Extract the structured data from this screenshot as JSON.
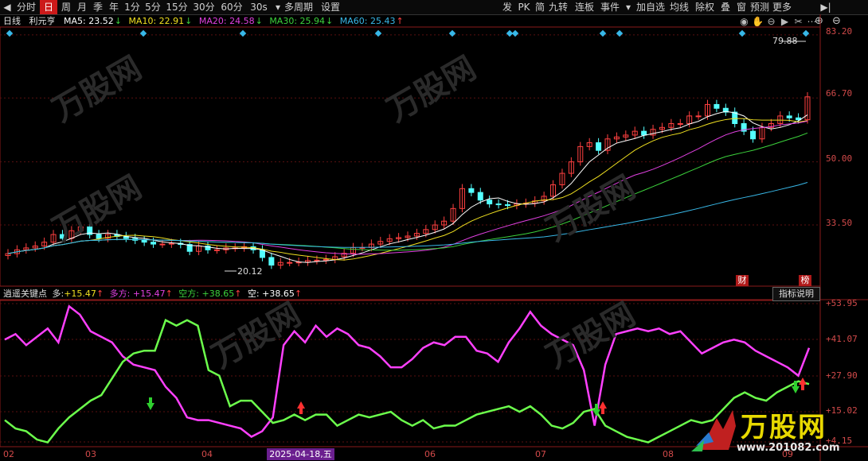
{
  "toolbar": {
    "left_arrow": "◀",
    "periods": [
      "分时",
      "日",
      "周",
      "月",
      "季",
      "年",
      "1分",
      "5分",
      "15分",
      "30分",
      "60分",
      "30s",
      "多周期",
      "设置"
    ],
    "active_period": "日",
    "seconds_dropdown": "▾",
    "tools": [
      "发",
      "PK",
      "简",
      "九转",
      "连板",
      "事件"
    ],
    "tools_dropdown": "▾",
    "right_tools": [
      "加自选",
      "均线",
      "除权",
      "叠",
      "窗",
      "预测",
      "更多"
    ],
    "right_arrow": "▶|"
  },
  "main_legend": {
    "period": "日线",
    "stock_name": "利元亨",
    "ma5": {
      "label": "MA5: 23.52",
      "arrow": "↓",
      "color": "#ffffff"
    },
    "ma10": {
      "label": "MA10: 22.91",
      "arrow": "↓",
      "color": "#f0e020"
    },
    "ma20": {
      "label": "MA20: 24.58",
      "arrow": "↓",
      "color": "#e040e0"
    },
    "ma30": {
      "label": "MA30: 25.94",
      "arrow": "↓",
      "color": "#3cd23c"
    },
    "ma60": {
      "label": "MA60: 25.43",
      "arrow": "↑",
      "color": "#38b8e8"
    }
  },
  "chart_icons": [
    "eye-icon",
    "hand-icon",
    "minus-circle-icon",
    "play-circle-icon",
    "scissors-icon",
    "dots-icon"
  ],
  "chart_icon_glyphs": [
    "◉",
    "✋",
    "⊖",
    "▶",
    "✂",
    "⋯"
  ],
  "zoom": {
    "plus": "⊕",
    "minus": "⊖"
  },
  "price_axis": [
    "83.20",
    "66.70",
    "50.00",
    "33.50"
  ],
  "price_high_label": "79.88",
  "price_low_label": "20.12",
  "tags": [
    {
      "text": "财",
      "color": "#b01a1a"
    },
    {
      "text": "榜",
      "color": "#b01a1a"
    }
  ],
  "indicator_legend": {
    "name": "逍遥关键点",
    "duo": {
      "label": "多: +15.47",
      "arrow": "↑",
      "color": "#f0e020"
    },
    "duofang": {
      "label": "多方: +15.47",
      "arrow": "↑",
      "color": "#e040e0"
    },
    "kongfang": {
      "label": "空方: +38.65",
      "arrow": "↑",
      "color": "#3cd23c"
    },
    "kong": {
      "label": "空: +38.65",
      "arrow": "↑",
      "color": "#ffffff"
    }
  },
  "explain_button": "指标说明",
  "indicator_axis": [
    "+53.95",
    "+41.07",
    "+27.90",
    "+15.02",
    "+4.15"
  ],
  "date_axis": [
    "02",
    "03",
    "04",
    "06",
    "07",
    "08",
    "09"
  ],
  "date_highlight": "2025-04-18,五",
  "watermark": {
    "brand": "万股网",
    "url": "www.201082.com"
  },
  "chart_data": [
    {
      "type": "candlestick",
      "title": "",
      "ylim": [
        20,
        84
      ],
      "ticks": [
        83.2,
        66.7,
        50.0,
        33.5
      ],
      "high": 79.88,
      "low": 20.12,
      "close_series": [
        26,
        27,
        27.5,
        28,
        29,
        31,
        30,
        32,
        33,
        31,
        30,
        31,
        30.5,
        30,
        29.5,
        29,
        28.5,
        28.5,
        28.7,
        28.4,
        26.6,
        28,
        27,
        27,
        27.5,
        27.5,
        27.8,
        27,
        25,
        23,
        23.7,
        23.7,
        23.8,
        24.2,
        24.3,
        24.5,
        25.2,
        26.1,
        27.6,
        27.6,
        28.5,
        29.2,
        29.9,
        30.2,
        30.6,
        31.3,
        32.3,
        33.5,
        34.5,
        37.8,
        43,
        42,
        40,
        39,
        38.8,
        38.6,
        39,
        39.2,
        39.8,
        41,
        44,
        47,
        50,
        54,
        55,
        53,
        56,
        56.5,
        57,
        58,
        57,
        58.5,
        59,
        60,
        60,
        62,
        62,
        65,
        64,
        63,
        60,
        58,
        56,
        59,
        60,
        62,
        61.5,
        61,
        67
      ]
    },
    {
      "type": "line",
      "title": "",
      "ylim": [
        4.15,
        53.95
      ],
      "ticks": [
        53.95,
        41.07,
        27.9,
        15.02,
        4.15
      ],
      "series": [
        {
          "name": "多方",
          "values": [
            41,
            43,
            39,
            42,
            45,
            40,
            53,
            50,
            44,
            42,
            40,
            35,
            32,
            31,
            30,
            24,
            20,
            13,
            12,
            12,
            11,
            10,
            9,
            6,
            8,
            13,
            39,
            44,
            40,
            46,
            42,
            45,
            43,
            39,
            38,
            35,
            31,
            31,
            34,
            38,
            40,
            39,
            42,
            42,
            37,
            36,
            33,
            40,
            45,
            51,
            46,
            43,
            41,
            39,
            30,
            10,
            32,
            43,
            44,
            45,
            44,
            45,
            43,
            44,
            40,
            36,
            38,
            40,
            41,
            40,
            37,
            35,
            33,
            31,
            28,
            38
          ]
        },
        {
          "name": "空方",
          "values": [
            12,
            9,
            8,
            5,
            4,
            9,
            13,
            16,
            19,
            21,
            27,
            33,
            36,
            37,
            37,
            48,
            46,
            48,
            46,
            30,
            28,
            17,
            19,
            19,
            15,
            11,
            12,
            14,
            12,
            14,
            14,
            10,
            12,
            14,
            13,
            14,
            15,
            12,
            10,
            12,
            9,
            10,
            10,
            12,
            14,
            15,
            16,
            17,
            15,
            17,
            14,
            10,
            9,
            11,
            15,
            16,
            10,
            8,
            6,
            5,
            4,
            6,
            8,
            10,
            12,
            11,
            12,
            16,
            20,
            22,
            20,
            19,
            22,
            24,
            26,
            25
          ]
        }
      ]
    }
  ]
}
